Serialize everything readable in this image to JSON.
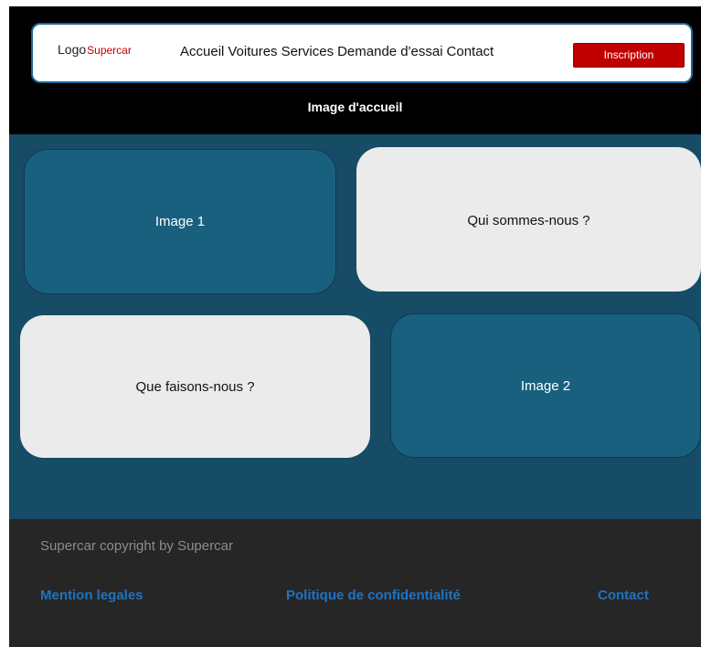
{
  "header": {
    "logo_text": "Logo",
    "logo_brand": "Supercar",
    "nav": [
      "Accueil",
      "Voitures",
      "Services",
      "Demande d'essai",
      "Contact"
    ],
    "signup_label": "Inscription",
    "hero_caption": "Image d'accueil"
  },
  "main": {
    "cards": {
      "image1": "Image 1",
      "who": "Qui sommes-nous ?",
      "what": "Que faisons-nous ?",
      "image2": "Image 2"
    }
  },
  "footer": {
    "copyright": "Supercar copyright by Supercar",
    "links": [
      "Mention legales",
      "Politique de confidentialité",
      "Contact"
    ]
  },
  "colors": {
    "brand_red": "#c00000",
    "hero_bg": "#000000",
    "content_bg": "#164c65",
    "card_blue": "#19607f",
    "card_light": "#ebebeb",
    "footer_bg": "#262626",
    "footer_link": "#1f73c2"
  }
}
